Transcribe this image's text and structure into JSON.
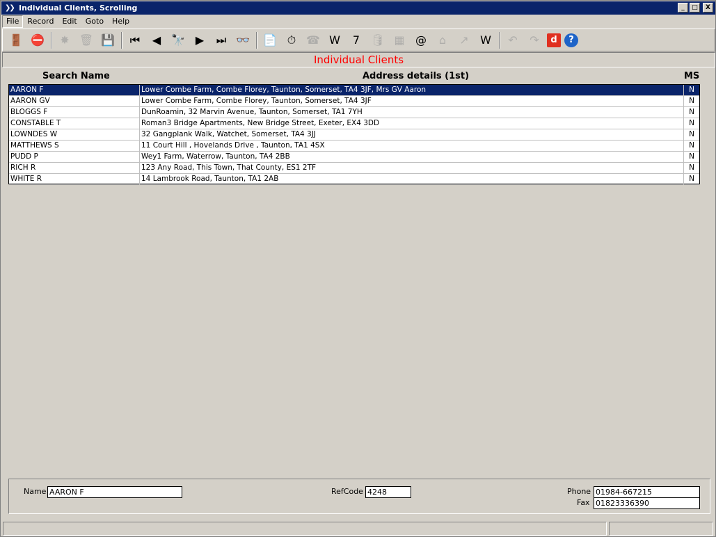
{
  "window": {
    "title": "Individual Clients, Scrolling",
    "buttons": [
      "_",
      "□",
      "X"
    ]
  },
  "menu": [
    "File",
    "Record",
    "Edit",
    "Goto",
    "Help"
  ],
  "toolbar": [
    {
      "name": "exit-icon",
      "glyph": "🚪"
    },
    {
      "name": "stop-icon",
      "glyph": "⛔"
    },
    {
      "sep": true
    },
    {
      "name": "new-icon",
      "glyph": "✸",
      "disabled": true
    },
    {
      "name": "delete-icon",
      "glyph": "🗑",
      "disabled": true
    },
    {
      "name": "save-icon",
      "glyph": "💾",
      "disabled": true
    },
    {
      "sep": true
    },
    {
      "name": "first-record-icon",
      "glyph": "⏮"
    },
    {
      "name": "previous-record-icon",
      "glyph": "◀"
    },
    {
      "name": "find-icon",
      "glyph": "🔭"
    },
    {
      "name": "next-record-icon",
      "glyph": "▶"
    },
    {
      "name": "last-record-icon",
      "glyph": "⏭"
    },
    {
      "name": "view-icon",
      "glyph": "👓"
    },
    {
      "sep": true
    },
    {
      "name": "notes-icon",
      "glyph": "📄"
    },
    {
      "name": "timer-icon",
      "glyph": "⏱"
    },
    {
      "name": "phone-icon",
      "glyph": "☎",
      "disabled": true
    },
    {
      "name": "word-icon",
      "glyph": "W"
    },
    {
      "name": "calendar-icon",
      "glyph": "7"
    },
    {
      "name": "database-icon",
      "glyph": "🛢",
      "disabled": true
    },
    {
      "name": "calculator-icon",
      "glyph": "▦",
      "disabled": true
    },
    {
      "name": "email-icon",
      "glyph": "@"
    },
    {
      "name": "home-icon",
      "glyph": "⌂",
      "disabled": true
    },
    {
      "name": "chart-icon",
      "glyph": "↗",
      "disabled": true
    },
    {
      "name": "web-icon",
      "glyph": "W"
    },
    {
      "sep": true
    },
    {
      "name": "undo-icon",
      "glyph": "↶",
      "disabled": true
    },
    {
      "name": "redo-icon",
      "glyph": "↷",
      "disabled": true
    },
    {
      "name": "d-icon",
      "glyph": "d",
      "color": "#e03020"
    },
    {
      "name": "help-icon",
      "glyph": "?",
      "color": "#1e64c8"
    }
  ],
  "header": {
    "title": "Individual Clients",
    "title_color": "#ff0000"
  },
  "columns": {
    "name": "Search Name",
    "address": "Address details (1st)",
    "ms": "MS"
  },
  "rows": [
    {
      "name": "AARON F",
      "address": "Lower Combe Farm, Combe Florey, Taunton, Somerset, TA4 3JF, Mrs GV Aaron",
      "ms": "N",
      "selected": true
    },
    {
      "name": "AARON GV",
      "address": "Lower Combe Farm, Combe Florey, Taunton, Somerset, TA4 3JF",
      "ms": "N"
    },
    {
      "name": "BLOGGS F",
      "address": "DunRoamin, 32 Marvin Avenue, Taunton, Somerset, TA1 7YH",
      "ms": "N"
    },
    {
      "name": "CONSTABLE T",
      "address": "Roman3 Bridge Apartments, New Bridge Street, Exeter, EX4 3DD",
      "ms": "N"
    },
    {
      "name": "LOWNDES W",
      "address": "32 Gangplank Walk, Watchet, Somerset, TA4 3JJ",
      "ms": "N"
    },
    {
      "name": "MATTHEWS S",
      "address": "11 Court Hill , Hovelands Drive , Taunton, TA1 4SX",
      "ms": "N"
    },
    {
      "name": "PUDD P",
      "address": "Wey1 Farm, Waterrow, Taunton, TA4 2BB",
      "ms": "N"
    },
    {
      "name": "RICH R",
      "address": "123 Any Road, This Town, That County, ES1 2TF",
      "ms": "N"
    },
    {
      "name": "WHITE R",
      "address": "14 Lambrook Road, Taunton, TA1 2AB",
      "ms": "N"
    }
  ],
  "details": {
    "name_label": "Name",
    "name_value": "AARON F",
    "refcode_label": "RefCode",
    "refcode_value": "4248",
    "phone_label": "Phone",
    "phone_value": "01984-667215",
    "fax_label": "Fax",
    "fax_value": "01823336390"
  }
}
